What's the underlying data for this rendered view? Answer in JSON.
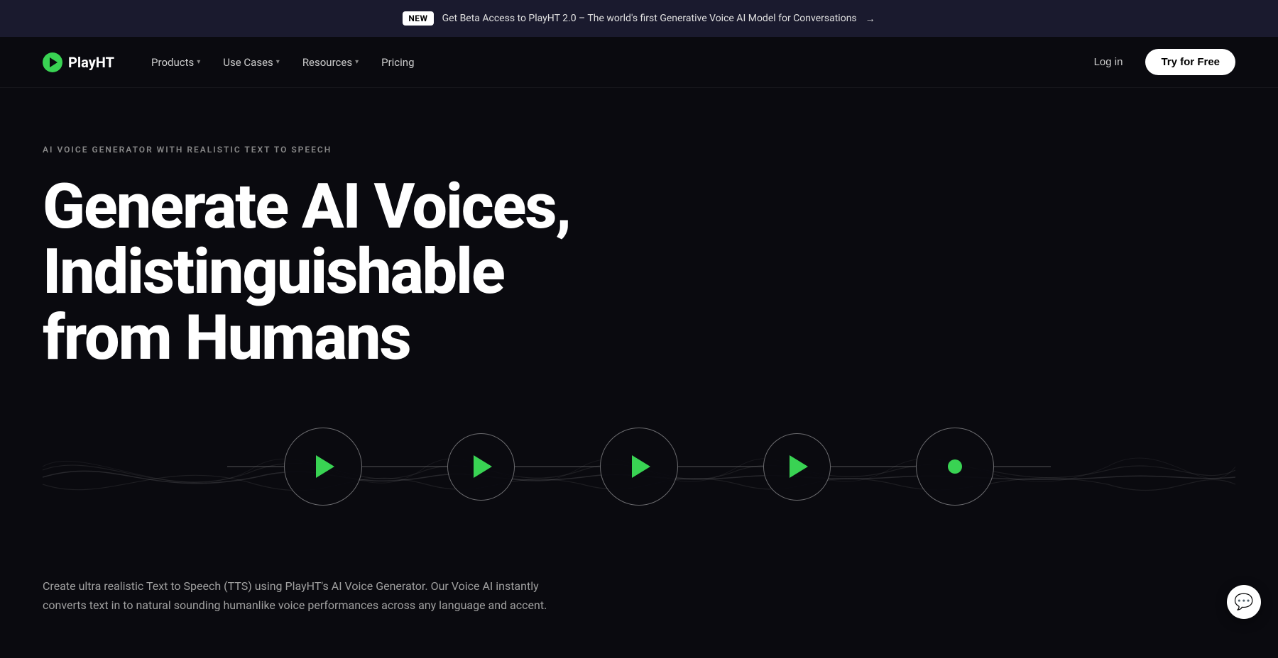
{
  "banner": {
    "badge": "NEW",
    "text": "Get Beta Access to PlayHT 2.0 – The world's first Generative Voice AI Model for Conversations",
    "arrow": "→"
  },
  "nav": {
    "logo_text": "PlayHT",
    "links": [
      {
        "label": "Products",
        "has_dropdown": true
      },
      {
        "label": "Use Cases",
        "has_dropdown": true
      },
      {
        "label": "Resources",
        "has_dropdown": true
      },
      {
        "label": "Pricing",
        "has_dropdown": false
      }
    ],
    "login_label": "Log in",
    "try_free_label": "Try for Free"
  },
  "hero": {
    "label": "AI VOICE GENERATOR WITH REALISTIC TEXT TO SPEECH",
    "title_line1": "Generate AI Voices,",
    "title_line2": "Indistinguishable from Humans",
    "description": "Create ultra realistic Text to Speech (TTS) using PlayHT's AI Voice Generator. Our Voice AI instantly converts text in to natural sounding humanlike voice performances across any language and accent.",
    "play_buttons": [
      {
        "type": "play",
        "size": "large"
      },
      {
        "type": "play",
        "size": "medium"
      },
      {
        "type": "play",
        "size": "large"
      },
      {
        "type": "play",
        "size": "medium"
      },
      {
        "type": "dot",
        "size": "large"
      }
    ]
  },
  "chat": {
    "icon": "💬"
  },
  "colors": {
    "accent_green": "#39d353",
    "bg_dark": "#0a0a0f",
    "bg_banner": "#1a1a2e"
  }
}
